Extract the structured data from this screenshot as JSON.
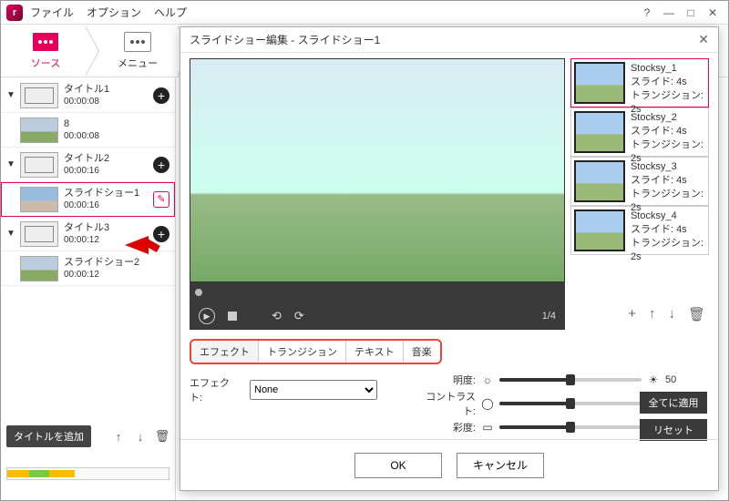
{
  "menubar": {
    "file": "ファイル",
    "option": "オプション",
    "help": "ヘルプ"
  },
  "tabs": {
    "source": "ソース",
    "menu": "メニュー"
  },
  "items": [
    {
      "type": "title",
      "name": "タイトル1",
      "time": "00:00:08",
      "toggle": "▼"
    },
    {
      "type": "clip",
      "name": "8",
      "time": "00:00:08",
      "thumb": "scene"
    },
    {
      "type": "title",
      "name": "タイトル2",
      "time": "00:00:16",
      "toggle": "▼"
    },
    {
      "type": "clip",
      "name": "スライドショー1",
      "time": "00:00:16",
      "thumb": "scene2",
      "selected": true,
      "edit": true
    },
    {
      "type": "title",
      "name": "タイトル3",
      "time": "00:00:12",
      "toggle": "▼"
    },
    {
      "type": "clip",
      "name": "スライドショー2",
      "time": "00:00:12",
      "thumb": "scene"
    }
  ],
  "add_title": "タイトルを追加",
  "modal": {
    "title": "スライドショー編集  -  スライドショー1",
    "counter": "1/4",
    "slides": [
      {
        "name": "Stocksy_1",
        "slide": "スライド: 4s",
        "trans": "トランジション: 2s",
        "sel": true
      },
      {
        "name": "Stocksy_2",
        "slide": "スライド: 4s",
        "trans": "トランジション: 2s"
      },
      {
        "name": "Stocksy_3",
        "slide": "スライド: 4s",
        "trans": "トランジション: 2s"
      },
      {
        "name": "Stocksy_4",
        "slide": "スライド: 4s",
        "trans": "トランジション: 2s"
      }
    ],
    "etabs": {
      "effect": "エフェクト",
      "transition": "トランジション",
      "text": "テキスト",
      "music": "音楽"
    },
    "effect_label": "エフェクト:",
    "effect_value": "None",
    "brightness": "明度:",
    "contrast": "コントラスト:",
    "saturation": "彩度:",
    "slider_val": "50",
    "apply_all": "全てに適用",
    "reset": "リセット",
    "ok": "OK",
    "cancel": "キャンセル"
  }
}
